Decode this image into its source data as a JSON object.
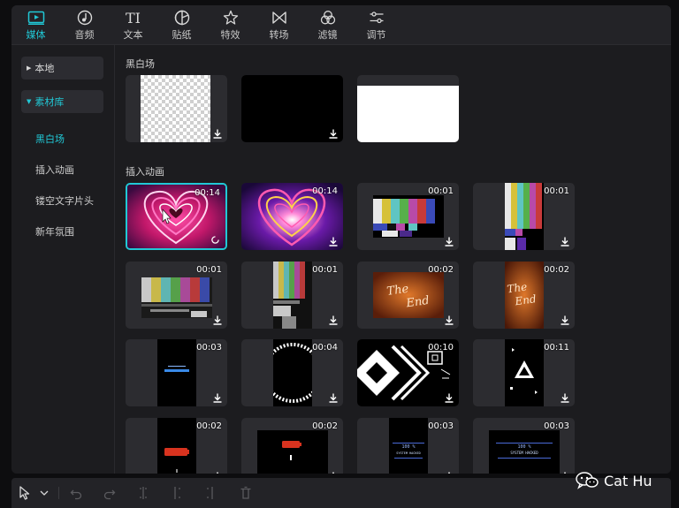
{
  "toolbar": {
    "tabs": [
      {
        "label": "媒体",
        "icon": "media-icon"
      },
      {
        "label": "音频",
        "icon": "audio-icon"
      },
      {
        "label": "文本",
        "icon": "text-icon"
      },
      {
        "label": "贴纸",
        "icon": "sticker-icon"
      },
      {
        "label": "特效",
        "icon": "effects-icon"
      },
      {
        "label": "转场",
        "icon": "transition-icon"
      },
      {
        "label": "滤镜",
        "icon": "filter-icon"
      },
      {
        "label": "调节",
        "icon": "adjust-icon"
      }
    ],
    "text_icon_glyph": "TI"
  },
  "sidebar": {
    "local": "本地",
    "library": "素材库",
    "items": [
      "黑白场",
      "插入动画",
      "镂空文字片头",
      "新年氛围"
    ]
  },
  "sections": {
    "bw": {
      "title": "黑白场"
    },
    "insert": {
      "title": "插入动画",
      "durations": [
        "00:14",
        "00:14",
        "00:01",
        "00:01",
        "00:01",
        "00:01",
        "00:02",
        "00:02",
        "00:03",
        "00:04",
        "00:10",
        "00:11",
        "00:02",
        "00:02",
        "00:03",
        "00:03"
      ],
      "end_text": [
        "The",
        "End"
      ],
      "system_text": [
        "100 %",
        "SYSTEM HACKED"
      ]
    }
  },
  "watermark": {
    "text": "Cat Hu",
    "icon": "wechat-icon"
  },
  "colors": {
    "accent": "#21c8d6",
    "panel": "#1c1c1f",
    "thumb_bg": "#2c2c30"
  }
}
